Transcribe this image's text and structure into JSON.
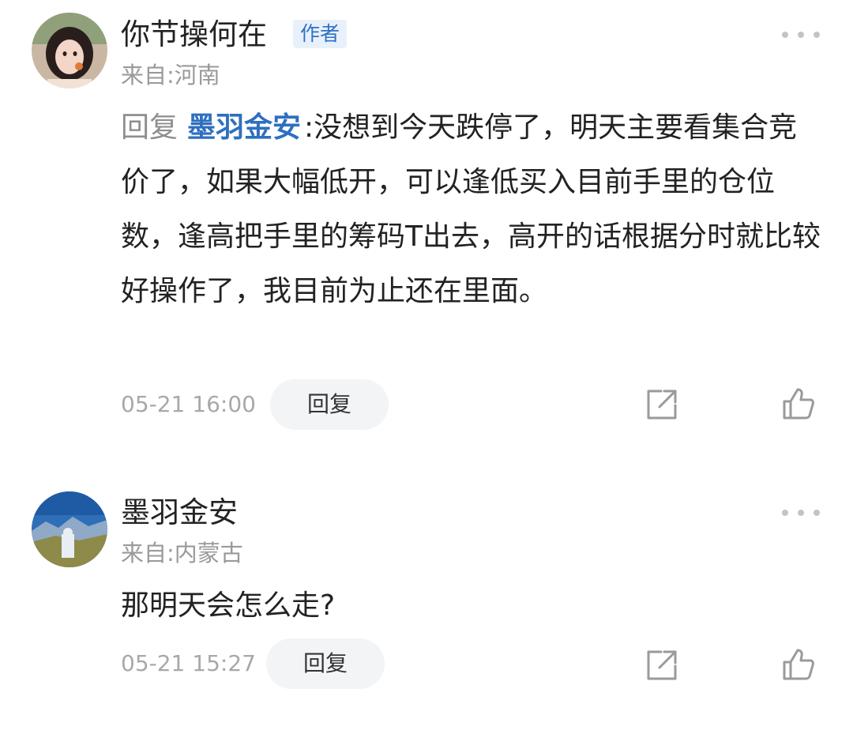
{
  "comments": [
    {
      "username": "你节操何在",
      "badge": "作者",
      "location": "来自:河南",
      "reply_prefix": "回复",
      "reply_target": "墨羽金安",
      "reply_sep": ":",
      "content": "没想到今天跌停了，明天主要看集合竞价了，如果大幅低开，可以逢低买入目前手里的仓位数，逢高把手里的筹码T出去，高开的话根据分时就比较好操作了，我目前为止还在里面。",
      "time": "05-21 16:00",
      "reply_button": "回复"
    },
    {
      "username": "墨羽金安",
      "location": "来自:内蒙古",
      "content": "那明天会怎么走?",
      "time": "05-21 15:27",
      "reply_button": "回复"
    }
  ],
  "icons": {
    "more": "more-icon",
    "share": "share-icon",
    "like": "thumbs-up-icon"
  },
  "colors": {
    "link_blue": "#2e6fbf",
    "badge_bg": "#e8f1fb",
    "muted_text": "#9a9a9a"
  }
}
